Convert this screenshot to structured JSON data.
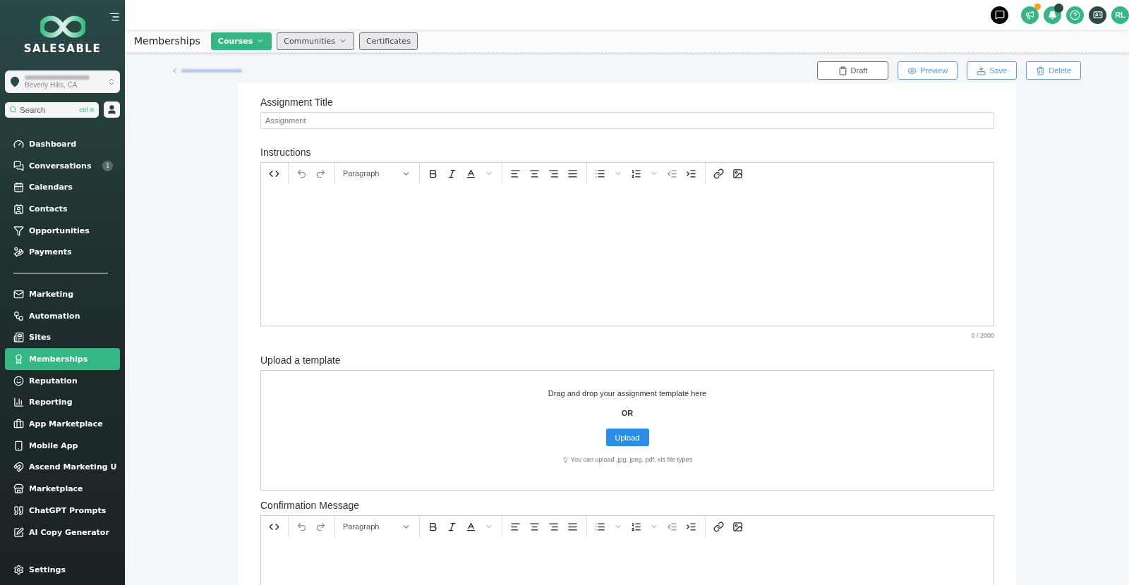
{
  "sidebar": {
    "brand": "SALESABLE",
    "location": {
      "subtitle": "Beverly Hills, CA"
    },
    "search": {
      "placeholder": "Search",
      "shortcut": "ctrl K"
    },
    "nav_groups": [
      [
        {
          "label": "Dashboard",
          "selected": false
        },
        {
          "label": "Conversations",
          "selected": false,
          "badge": "1"
        },
        {
          "label": "Calendars",
          "selected": false
        },
        {
          "label": "Contacts",
          "selected": false
        },
        {
          "label": "Opportunities",
          "selected": false
        },
        {
          "label": "Payments",
          "selected": false
        }
      ],
      [
        {
          "label": "Marketing",
          "selected": false
        },
        {
          "label": "Automation",
          "selected": false
        },
        {
          "label": "Sites",
          "selected": false
        },
        {
          "label": "Memberships",
          "selected": true
        },
        {
          "label": "Reputation",
          "selected": false
        },
        {
          "label": "Reporting",
          "selected": false
        },
        {
          "label": "App Marketplace",
          "selected": false
        },
        {
          "label": "Mobile App",
          "selected": false
        },
        {
          "label": "Ascend Marketing U",
          "selected": false
        },
        {
          "label": "Marketplace",
          "selected": false
        },
        {
          "label": "ChatGPT Prompts",
          "selected": false
        },
        {
          "label": "AI Copy Generator",
          "selected": false
        }
      ]
    ],
    "settings": {
      "label": "Settings",
      "selected": false
    }
  },
  "header": {
    "avatar": "RL"
  },
  "subnav": {
    "title": "Memberships",
    "tabs": [
      {
        "label": "Courses",
        "selected": true,
        "dropdown": true
      },
      {
        "label": "Communities",
        "selected": false,
        "dropdown": true
      },
      {
        "label": "Certificates",
        "selected": false,
        "dropdown": false
      }
    ]
  },
  "actions": [
    "Draft",
    "Preview",
    "Save",
    "Delete"
  ],
  "form": {
    "title_label": "Assignment Title",
    "title_placeholder": "Assignment",
    "instructions": {
      "label": "Instructions",
      "block_format": "Paragraph",
      "counter": "0 / 2000"
    },
    "upload": {
      "label": "Upload a template",
      "prompt": "Drag and drop your assignment template here",
      "or": "OR",
      "button": "Upload",
      "hint": "You can upload .jpg, jpeg, pdf, xls file types"
    },
    "confirmation": {
      "label": "Confirmation Message",
      "block_format": "Paragraph"
    }
  }
}
